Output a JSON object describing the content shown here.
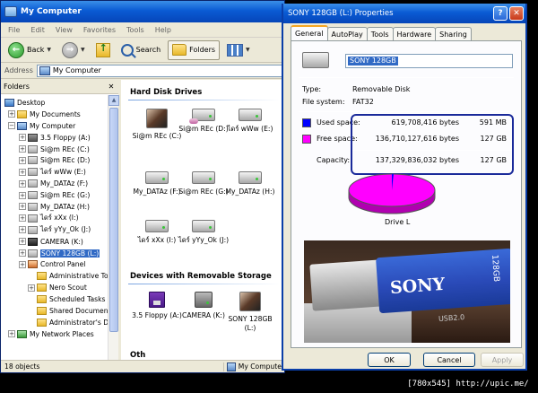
{
  "explorer": {
    "title": "My Computer",
    "menu": [
      "File",
      "Edit",
      "View",
      "Favorites",
      "Tools",
      "Help"
    ],
    "toolbar": {
      "back": "Back",
      "search": "Search",
      "folders": "Folders"
    },
    "address_label": "Address",
    "address_value": "My Computer",
    "folders_pane_title": "Folders",
    "tree": [
      {
        "label": "Desktop",
        "icon": "desktop-icon",
        "expander": ""
      },
      {
        "label": "My Documents",
        "icon": "folder-icon",
        "expander": "+"
      },
      {
        "label": "My Computer",
        "icon": "computer-icon",
        "expander": "−"
      },
      {
        "label": "3.5 Floppy (A:)",
        "icon": "floppy-icon",
        "expander": "+"
      },
      {
        "label": "Si@m REc (C:)",
        "icon": "drive-icon",
        "expander": "+"
      },
      {
        "label": "Si@m REc (D:)",
        "icon": "drive-icon",
        "expander": "+"
      },
      {
        "label": "ไดร์ wWw (E:)",
        "icon": "drive-icon",
        "expander": "+"
      },
      {
        "label": "My_DATAz (F:)",
        "icon": "drive-icon",
        "expander": "+"
      },
      {
        "label": "Si@m REc (G:)",
        "icon": "drive-icon",
        "expander": "+"
      },
      {
        "label": "My_DATAz (H:)",
        "icon": "drive-icon",
        "expander": "+"
      },
      {
        "label": "ไดร์ xXx (I:)",
        "icon": "drive-icon",
        "expander": "+"
      },
      {
        "label": "ไดร์ yYy_Ok (J:)",
        "icon": "drive-icon",
        "expander": "+"
      },
      {
        "label": "CAMERA (K:)",
        "icon": "camera-icon",
        "expander": "+"
      },
      {
        "label": "SONY 128GB (L:)",
        "icon": "drive-icon",
        "expander": "+"
      },
      {
        "label": "Control Panel",
        "icon": "control-panel-icon",
        "expander": "+"
      },
      {
        "label": "Administrative Too",
        "icon": "folder-icon",
        "expander": ""
      },
      {
        "label": "Nero Scout",
        "icon": "folder-icon",
        "expander": "+"
      },
      {
        "label": "Scheduled Tasks",
        "icon": "folder-icon",
        "expander": ""
      },
      {
        "label": "Shared Documents",
        "icon": "folder-icon",
        "expander": ""
      },
      {
        "label": "Administrator's Doc",
        "icon": "folder-icon",
        "expander": ""
      },
      {
        "label": "My Network Places",
        "icon": "network-icon",
        "expander": "+"
      }
    ],
    "hard_disk_heading": "Hard Disk Drives",
    "hard_drives": [
      {
        "label": "Si@m REc (C:)",
        "icon": "avatar"
      },
      {
        "label": "Si@m REc (D:)",
        "icon": "shared"
      },
      {
        "label": "ไดร์ wWw (E:)",
        "icon": "plain"
      },
      {
        "label": "My_DATAz (F:)",
        "icon": "plain"
      },
      {
        "label": "Si@m REc (G:)",
        "icon": "plain"
      },
      {
        "label": "My_DATAz (H:)",
        "icon": "plain"
      },
      {
        "label": "ไดร์ xXx (I:)",
        "icon": "plain"
      },
      {
        "label": "ไดร์ yYy_Ok (J:)",
        "icon": "plain"
      }
    ],
    "removable_heading": "Devices with Removable Storage",
    "removable": [
      {
        "label": "3.5 Floppy (A:)",
        "icon": "floppy"
      },
      {
        "label": "CAMERA (K:)",
        "icon": "camera"
      },
      {
        "label": "SONY 128GB (L:)",
        "icon": "avatar"
      }
    ],
    "other_heading": "Oth",
    "status_left": "18 objects",
    "status_right": "My Computer"
  },
  "dialog": {
    "title": "SONY 128GB (L:) Properties",
    "tabs": [
      "General",
      "AutoPlay",
      "Tools",
      "Hardware",
      "Sharing"
    ],
    "volume_label": "SONY 128GB",
    "type_label": "Type:",
    "type_value": "Removable Disk",
    "fs_label": "File system:",
    "fs_value": "FAT32",
    "used_label": "Used space:",
    "used_bytes": "619,708,416 bytes",
    "used_short": "591 MB",
    "free_label": "Free space:",
    "free_bytes": "136,710,127,616 bytes",
    "free_short": "127 GB",
    "capacity_label": "Capacity:",
    "capacity_bytes": "137,329,836,032 bytes",
    "capacity_short": "127 GB",
    "used_color": "#0000ff",
    "free_color": "#ff00ff",
    "drive_caption": "Drive L",
    "used_fraction": 0.0045,
    "photo": {
      "brand": "SONY",
      "capacity": "128GB",
      "interface": "USB2.0"
    },
    "ok": "OK",
    "cancel": "Cancel",
    "apply": "Apply"
  },
  "credit": "[780x545] http://upic.me/"
}
